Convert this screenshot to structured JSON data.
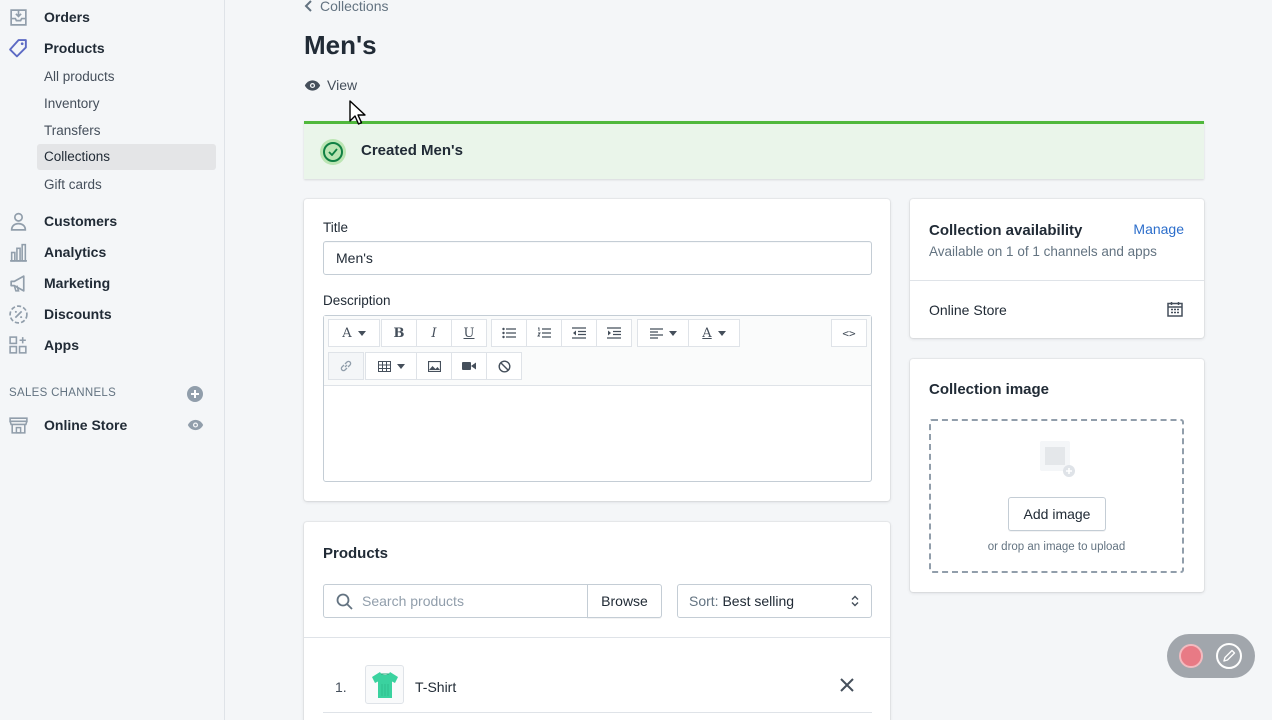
{
  "sidebar": {
    "main_items": [
      {
        "label": "Orders",
        "icon": "orders-icon"
      },
      {
        "label": "Products",
        "icon": "tag-icon"
      }
    ],
    "product_sub_items": [
      {
        "label": "All products"
      },
      {
        "label": "Inventory"
      },
      {
        "label": "Transfers"
      },
      {
        "label": "Collections",
        "active": true
      },
      {
        "label": "Gift cards"
      }
    ],
    "other_items": [
      {
        "label": "Customers",
        "icon": "person-icon"
      },
      {
        "label": "Analytics",
        "icon": "bar-chart-icon"
      },
      {
        "label": "Marketing",
        "icon": "megaphone-icon"
      },
      {
        "label": "Discounts",
        "icon": "discount-icon"
      },
      {
        "label": "Apps",
        "icon": "apps-grid-icon"
      }
    ],
    "sales_channels_heading": "SALES CHANNELS",
    "online_store_label": "Online Store"
  },
  "header": {
    "breadcrumb": "Collections",
    "title": "Men's",
    "view_label": "View"
  },
  "banner": {
    "message": "Created Men's",
    "color": "#50b83c"
  },
  "details_card": {
    "title_label": "Title",
    "title_value": "Men's",
    "description_label": "Description",
    "toolbar": {
      "font_glyph": "A",
      "bold_glyph": "B",
      "italic_glyph": "I",
      "underline_glyph": "U",
      "text_color_glyph": "A",
      "html_glyph": "<>"
    }
  },
  "products_card": {
    "title": "Products",
    "search_placeholder": "Search products",
    "browse_label": "Browse",
    "sort_prefix": "Sort:",
    "sort_value": "Best selling",
    "items": [
      {
        "index": "1.",
        "name": "T-Shirt",
        "thumb_color": "#3ad29f"
      }
    ]
  },
  "availability_card": {
    "title": "Collection availability",
    "manage_label": "Manage",
    "subtitle": "Available on 1 of 1 channels and apps",
    "channel": "Online Store"
  },
  "image_card": {
    "title": "Collection image",
    "add_image_label": "Add image",
    "hint": "or drop an image to upload"
  }
}
